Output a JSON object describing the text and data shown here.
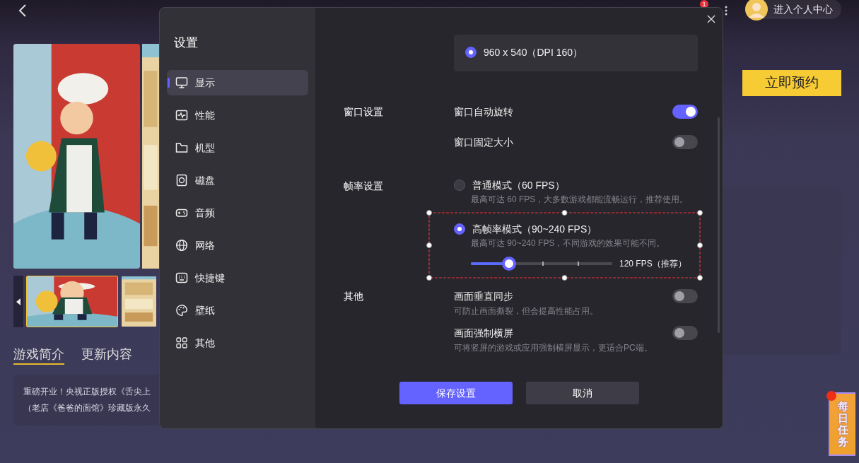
{
  "header": {
    "notification_badge": "1",
    "profile_label": "进入个人中心"
  },
  "game": {
    "thumbnails": [
      {
        "selected": true
      },
      {
        "selected": false
      }
    ],
    "tabs": [
      {
        "label": "游戏简介",
        "selected": true
      },
      {
        "label": "更新内容",
        "selected": false
      }
    ],
    "description": [
      "重磅开业！央视正版授权《舌尖上",
      "（老店《爸爸的面馆》珍藏版永久"
    ],
    "reserve_button": "立即预约"
  },
  "daily_task": {
    "label": "每日任务"
  },
  "settings": {
    "title": "设置",
    "nav": [
      {
        "label": "显示",
        "selected": true
      },
      {
        "label": "性能",
        "selected": false
      },
      {
        "label": "机型",
        "selected": false
      },
      {
        "label": "磁盘",
        "selected": false
      },
      {
        "label": "音频",
        "selected": false
      },
      {
        "label": "网络",
        "selected": false
      },
      {
        "label": "快捷键",
        "selected": false
      },
      {
        "label": "壁纸",
        "selected": false
      },
      {
        "label": "其他",
        "selected": false
      }
    ],
    "resolution_options": [
      {
        "label": "960 x 540（DPI 160）",
        "selected": true
      }
    ],
    "sections": [
      {
        "label": "窗口设置",
        "items": [
          {
            "kind": "toggle",
            "label": "窗口自动旋转",
            "on": true
          },
          {
            "kind": "toggle",
            "label": "窗口固定大小",
            "on": false
          }
        ]
      },
      {
        "label": "帧率设置",
        "items": [
          {
            "kind": "radio",
            "label": "普通模式（60 FPS）",
            "description": "最高可达 60 FPS，大多数游戏都能流畅运行，推荐使用。",
            "selected": false,
            "highlighted": false
          },
          {
            "kind": "radio",
            "label": "高帧率模式（90~240 FPS）",
            "description": "最高可达 90~240 FPS，不同游戏的效果可能不同。",
            "selected": true,
            "highlighted": true,
            "slider": {
              "level": 0.27,
              "reading": "120 FPS（推荐）"
            }
          }
        ]
      },
      {
        "label": "其他",
        "items": [
          {
            "kind": "toggle",
            "label": "画面垂直同步",
            "description": "可防止画面撕裂，但会提高性能占用。",
            "on": false
          },
          {
            "kind": "toggle",
            "label": "画面强制横屏",
            "description": "可将竖屏的游戏或应用强制横屏显示，更适合PC端。",
            "on": false
          }
        ]
      }
    ],
    "buttons": [
      {
        "label": "保存设置",
        "kind": "primary"
      },
      {
        "label": "取消",
        "kind": "secondary"
      }
    ]
  }
}
